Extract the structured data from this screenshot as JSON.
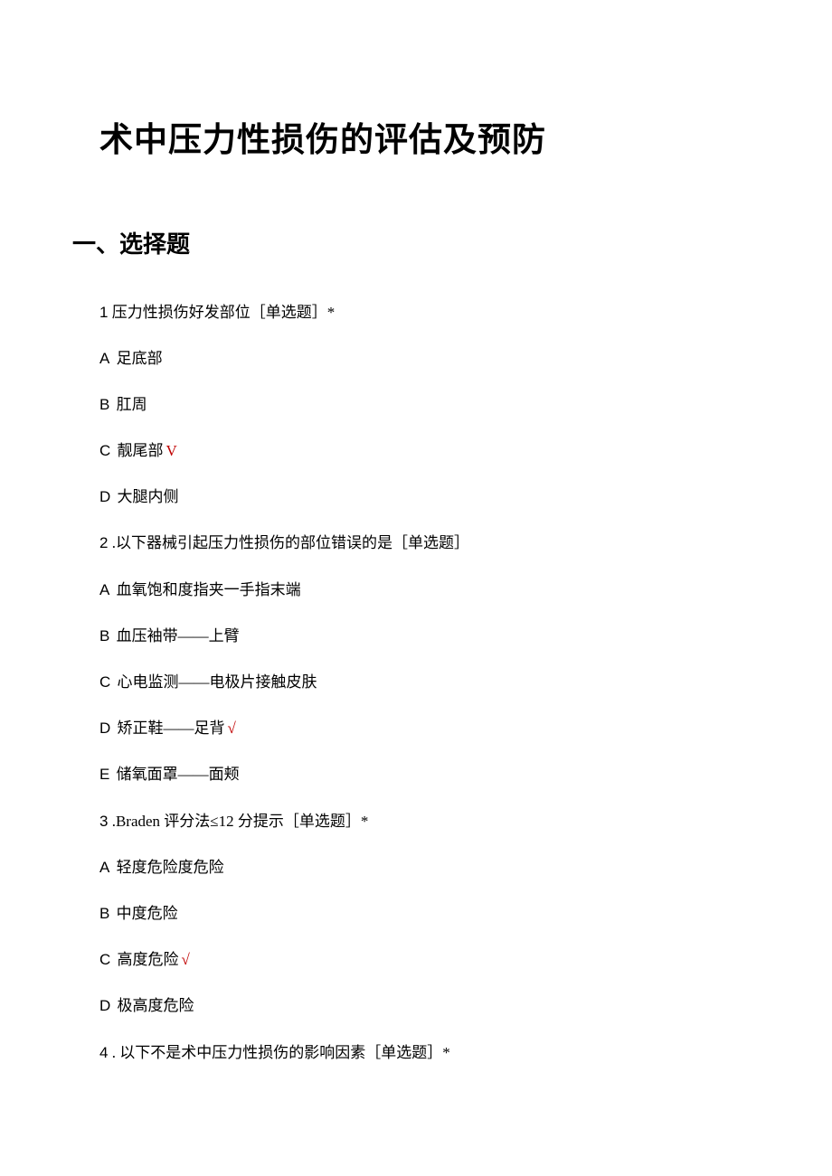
{
  "title": "术中压力性损伤的评估及预防",
  "section_heading": "一、选择题",
  "checkmark": "√",
  "check_v": "V",
  "questions": [
    {
      "num": "1",
      "stem_prefix": " 压力性损伤好发部位［单选题］",
      "star": "*",
      "options": [
        {
          "label": "A",
          "text": "足底部",
          "correct": false
        },
        {
          "label": "B",
          "text": "肛周",
          "correct": false
        },
        {
          "label": "C",
          "text": "靓尾部",
          "correct": true,
          "mark": "V"
        },
        {
          "label": "D",
          "text": "大腿内侧",
          "correct": false
        }
      ]
    },
    {
      "num": "2",
      "stem_prefix": " .以下器械引起压力性损伤的部位错误的是［单选题］",
      "star": "",
      "options": [
        {
          "label": "A",
          "text": "血氧饱和度指夹一手指末端",
          "correct": false
        },
        {
          "label": "B",
          "text": "血压袖带——上臂",
          "correct": false
        },
        {
          "label": "C",
          "text": "心电监测——电极片接触皮肤",
          "correct": false
        },
        {
          "label": "D",
          "text": "矫正鞋——足背",
          "correct": true,
          "mark": "√"
        },
        {
          "label": "E",
          "text": "储氧面罩——面颊",
          "correct": false
        }
      ]
    },
    {
      "num": "3",
      "stem_prefix": " .Braden 评分法≤12 分提示［单选题］",
      "star": "*",
      "options": [
        {
          "label": "A",
          "text": "轻度危险度危险",
          "correct": false
        },
        {
          "label": "B",
          "text": "中度危险",
          "correct": false
        },
        {
          "label": "C",
          "text": "高度危险",
          "correct": true,
          "mark": "√"
        },
        {
          "label": "D",
          "text": "极高度危险",
          "correct": false
        }
      ]
    },
    {
      "num": "4",
      "stem_prefix": " . 以下不是术中压力性损伤的影响因素［单选题］",
      "star": "*",
      "options": []
    }
  ]
}
